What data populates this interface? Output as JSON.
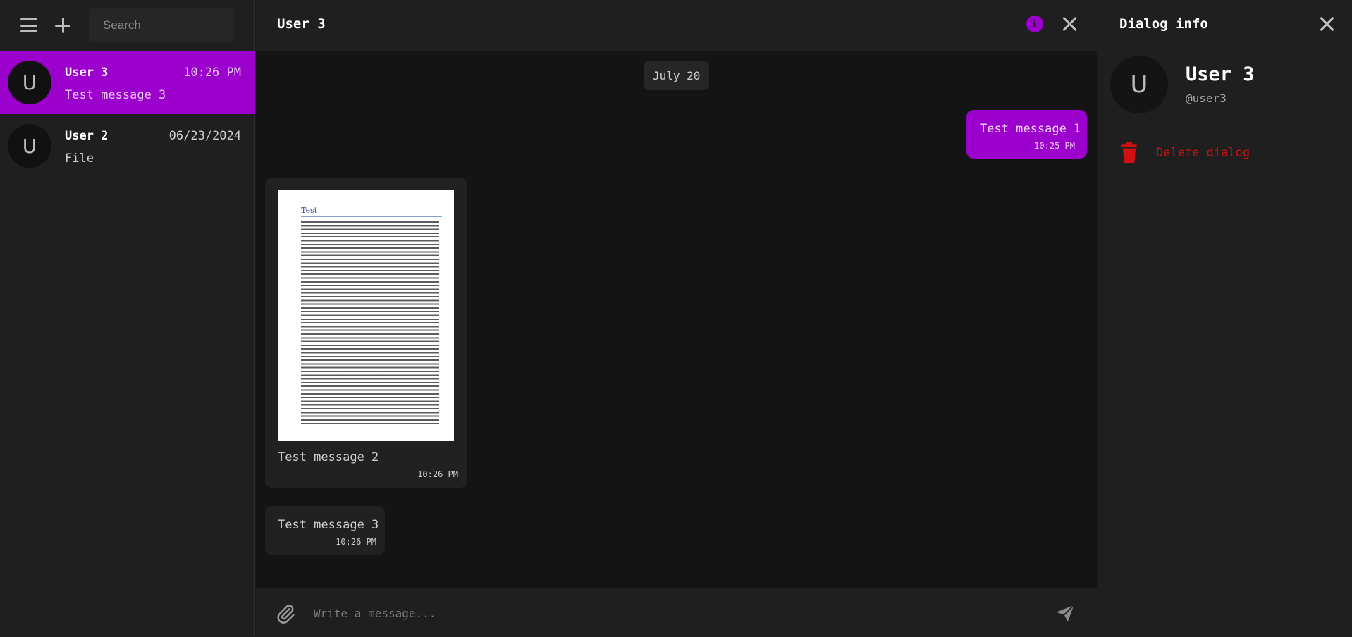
{
  "sidebar": {
    "search_placeholder": "Search",
    "chats": [
      {
        "name": "User 3",
        "time": "10:26 PM",
        "last_message": "Test message 3",
        "avatar_letter": "U",
        "active": true
      },
      {
        "name": "User 2",
        "time": "06/23/2024",
        "last_message": "File",
        "avatar_letter": "U",
        "active": false
      }
    ]
  },
  "chat": {
    "title": "User 3",
    "info_icon_glyph": "i",
    "date_separator": "July 20",
    "messages": [
      {
        "direction": "outgoing",
        "text": "Test message 1",
        "time": "10:25 PM"
      },
      {
        "direction": "incoming",
        "type": "file",
        "preview_title": "Test",
        "text": "Test message 2",
        "time": "10:26 PM"
      },
      {
        "direction": "incoming",
        "text": "Test message 3",
        "time": "10:26 PM"
      }
    ],
    "composer_placeholder": "Write a message..."
  },
  "info_panel": {
    "title": "Dialog info",
    "user_name": "User 3",
    "user_handle": "@user3",
    "avatar_letter": "U",
    "delete_label": "Delete dialog"
  },
  "icons": {
    "menu": "menu-icon",
    "new_chat": "plus-icon",
    "info": "info-icon",
    "close": "close-icon",
    "attach": "paperclip-icon",
    "send": "send-icon",
    "delete": "trash-icon"
  },
  "colors": {
    "accent": "#9b00cc",
    "danger": "#d11010",
    "panel_bg": "#1f1f1f",
    "chat_bg": "#141414"
  }
}
